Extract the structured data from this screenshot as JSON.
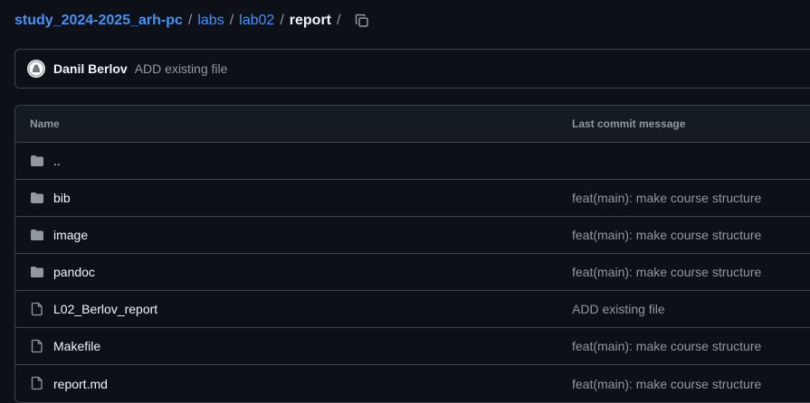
{
  "breadcrumb": {
    "repo": "study_2024-2025_arh-pc",
    "sep": "/",
    "path1": "labs",
    "path2": "lab02",
    "current": "report"
  },
  "latest_commit": {
    "author": "Danil Berlov",
    "message": "ADD existing file"
  },
  "table": {
    "headers": {
      "name": "Name",
      "last_commit": "Last commit message"
    },
    "rows": [
      {
        "name": "..",
        "type": "folder",
        "message": ""
      },
      {
        "name": "bib",
        "type": "folder",
        "message": "feat(main): make course structure"
      },
      {
        "name": "image",
        "type": "folder",
        "message": "feat(main): make course structure"
      },
      {
        "name": "pandoc",
        "type": "folder",
        "message": "feat(main): make course structure"
      },
      {
        "name": "L02_Berlov_report",
        "type": "file",
        "message": "ADD existing file"
      },
      {
        "name": "Makefile",
        "type": "file",
        "message": "feat(main): make course structure"
      },
      {
        "name": "report.md",
        "type": "file",
        "message": "feat(main): make course structure"
      }
    ]
  },
  "icons": {
    "copy": "copy-icon",
    "folder": "folder-icon",
    "file": "file-icon",
    "avatar": "avatar-icon"
  },
  "colors": {
    "background": "#0d1117",
    "link": "#4493f8",
    "muted": "#9198a1",
    "border": "#3d444d",
    "icon": "#9198a1"
  }
}
